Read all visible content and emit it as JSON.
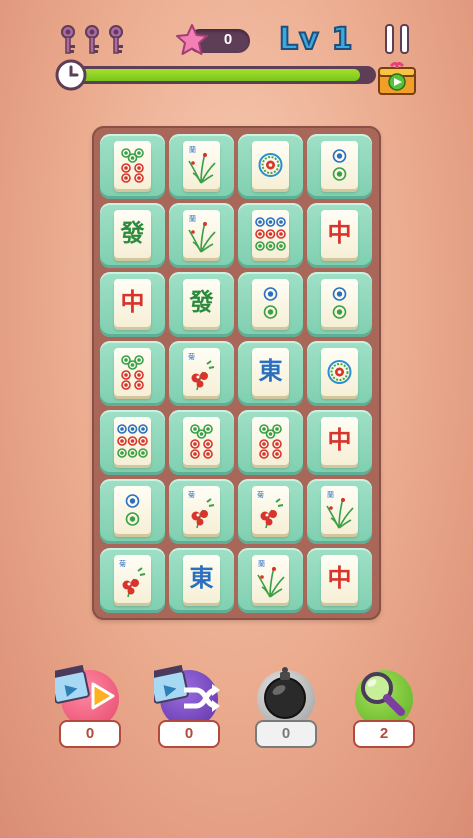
{
  "hud": {
    "keys": [
      "key-icon",
      "key-icon",
      "key-icon"
    ],
    "stars": "0",
    "level_prefix": "Lv",
    "level": "1",
    "timer_progress": 0.96
  },
  "tiles": [
    [
      "bamboo-6",
      "flower-orchid",
      "circle-1",
      "circle-2"
    ],
    [
      "green-dragon",
      "flower-orchid",
      "circle-9",
      "red-dragon"
    ],
    [
      "red-dragon",
      "green-dragon",
      "circle-2",
      "circle-2"
    ],
    [
      "bamboo-6",
      "flower-chrysanthemum",
      "east-wind",
      "circle-1"
    ],
    [
      "circle-9",
      "bamboo-6",
      "bamboo-6",
      "red-dragon"
    ],
    [
      "circle-2",
      "flower-chrysanthemum",
      "flower-chrysanthemum",
      "flower-orchid"
    ],
    [
      "flower-chrysanthemum",
      "east-wind",
      "flower-orchid",
      "red-dragon"
    ]
  ],
  "glyphs": {
    "red_dragon": "中",
    "green_dragon": "發",
    "east_wind": "東"
  },
  "tools": [
    {
      "name": "undo-video",
      "icon": "play-video-icon",
      "count": "0",
      "color": "#e6476b"
    },
    {
      "name": "shuffle-video",
      "icon": "shuffle-icon",
      "count": "0",
      "color": "#6a3fb2"
    },
    {
      "name": "bomb",
      "icon": "bomb-icon",
      "count": "0",
      "color": "#2a2a2a"
    },
    {
      "name": "hint",
      "icon": "magnifier-icon",
      "count": "2",
      "color": "#6fc42c"
    }
  ],
  "colors": {
    "accent": "#3ba9e0",
    "timer": "#8ad424",
    "board": "#a86758",
    "tile": "#8fd8bd"
  }
}
